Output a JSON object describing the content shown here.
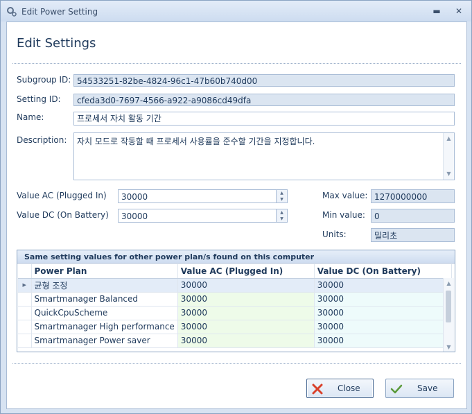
{
  "window": {
    "title": "Edit Power Setting",
    "minimize_label": "▬",
    "close_label": "✕"
  },
  "heading": "Edit Settings",
  "fields": {
    "subgroup_label": "Subgroup ID:",
    "subgroup_value": "54533251-82be-4824-96c1-47b60b740d00",
    "setting_label": "Setting ID:",
    "setting_value": "cfeda3d0-7697-4566-a922-a9086cd49dfa",
    "name_label": "Name:",
    "name_value": "프로세서 자치 활동 기간",
    "description_label": "Description:",
    "description_value": "자치 모드로 작동할 때 프로세서 사용률을 준수할 기간을 지정합니다."
  },
  "values": {
    "ac_label": "Value AC (Plugged In)",
    "ac_value": "30000",
    "dc_label": "Value DC (On Battery)",
    "dc_value": "30000",
    "max_label": "Max value:",
    "max_value": "1270000000",
    "min_label": "Min value:",
    "min_value": "0",
    "units_label": "Units:",
    "units_value": "밀리초"
  },
  "group": {
    "caption": "Same setting values for other power plan/s found on this computer",
    "columns": [
      "Power Plan",
      "Value AC (Plugged In)",
      "Value DC (On Battery)"
    ],
    "rows": [
      {
        "plan": "균형 조정",
        "ac": "30000",
        "dc": "30000"
      },
      {
        "plan": "Smartmanager Balanced",
        "ac": "30000",
        "dc": "30000"
      },
      {
        "plan": "QuickCpuScheme",
        "ac": "30000",
        "dc": "30000"
      },
      {
        "plan": "Smartmanager High performance",
        "ac": "30000",
        "dc": "30000"
      },
      {
        "plan": "Smartmanager Power saver",
        "ac": "30000",
        "dc": "30000"
      }
    ]
  },
  "buttons": {
    "close_label": "Close",
    "save_label": "Save"
  },
  "colors": {
    "accent": "#1e395b",
    "readonly_bg": "#dbe5f1",
    "ac_cell": "#eefbe9",
    "dc_cell": "#eefbfb",
    "close_icon": "#d9412b",
    "save_icon": "#5a9a3a"
  }
}
